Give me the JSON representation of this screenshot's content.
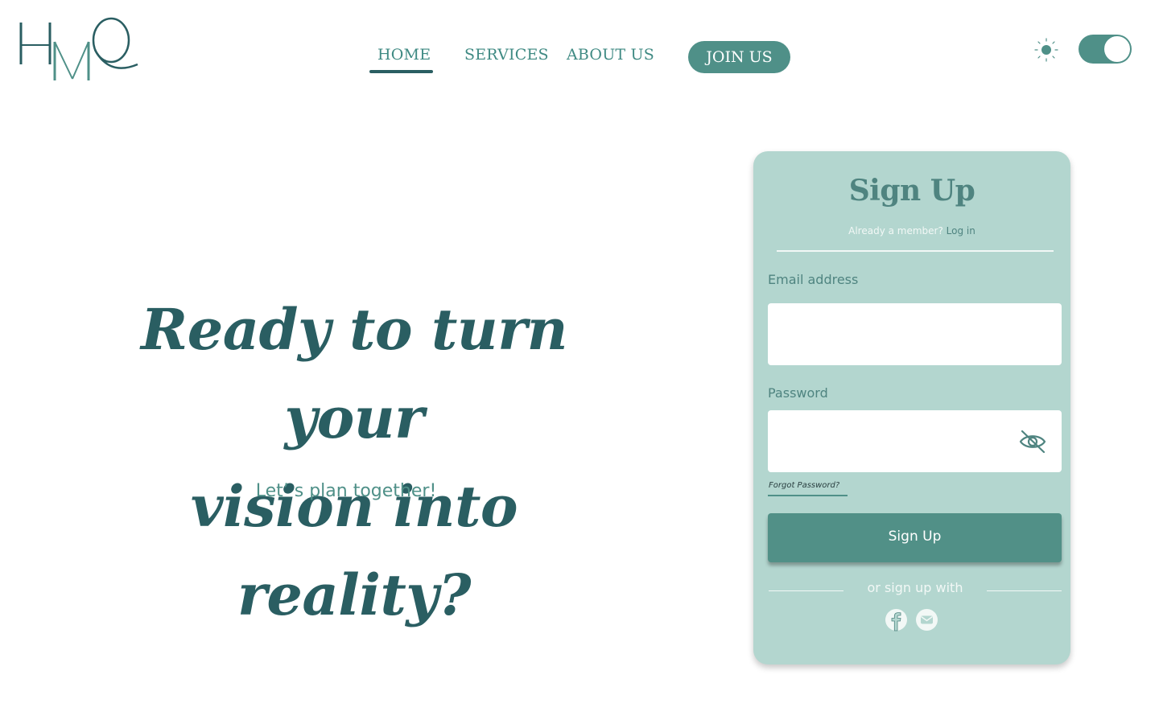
{
  "logo": {
    "text": "HMQ",
    "letters": [
      "H",
      "M",
      "Q"
    ],
    "icon": "hmq-logo"
  },
  "nav": {
    "items": [
      {
        "label": "HOME",
        "active": true
      },
      {
        "label": "SERVICES",
        "active": false
      },
      {
        "label": "ABOUT US",
        "active": false
      }
    ],
    "join_label": "JOIN US"
  },
  "theme": {
    "sun_icon": "sun-icon",
    "toggle_state": "on"
  },
  "hero": {
    "title_line1": "Ready to turn your",
    "title_line2": "vision into reality?",
    "subtitle": "Let’ s plan together!"
  },
  "signup": {
    "title": "Sign Up",
    "already_text": "Already a member?",
    "login_link": "Log in",
    "email_label": "Email address",
    "email_value": "",
    "password_label": "Password",
    "password_value": "",
    "eye_icon": "eye-slash-icon",
    "forgot_label": "Forgot Password?",
    "button_label": "Sign Up",
    "or_text": "or sign up with",
    "social": [
      {
        "icon": "facebook-icon"
      },
      {
        "icon": "mail-icon"
      }
    ]
  },
  "colors": {
    "primary_dark": "#2a5e62",
    "accent": "#4f9088",
    "card_bg": "#b3d6cf",
    "white": "#ffffff"
  }
}
